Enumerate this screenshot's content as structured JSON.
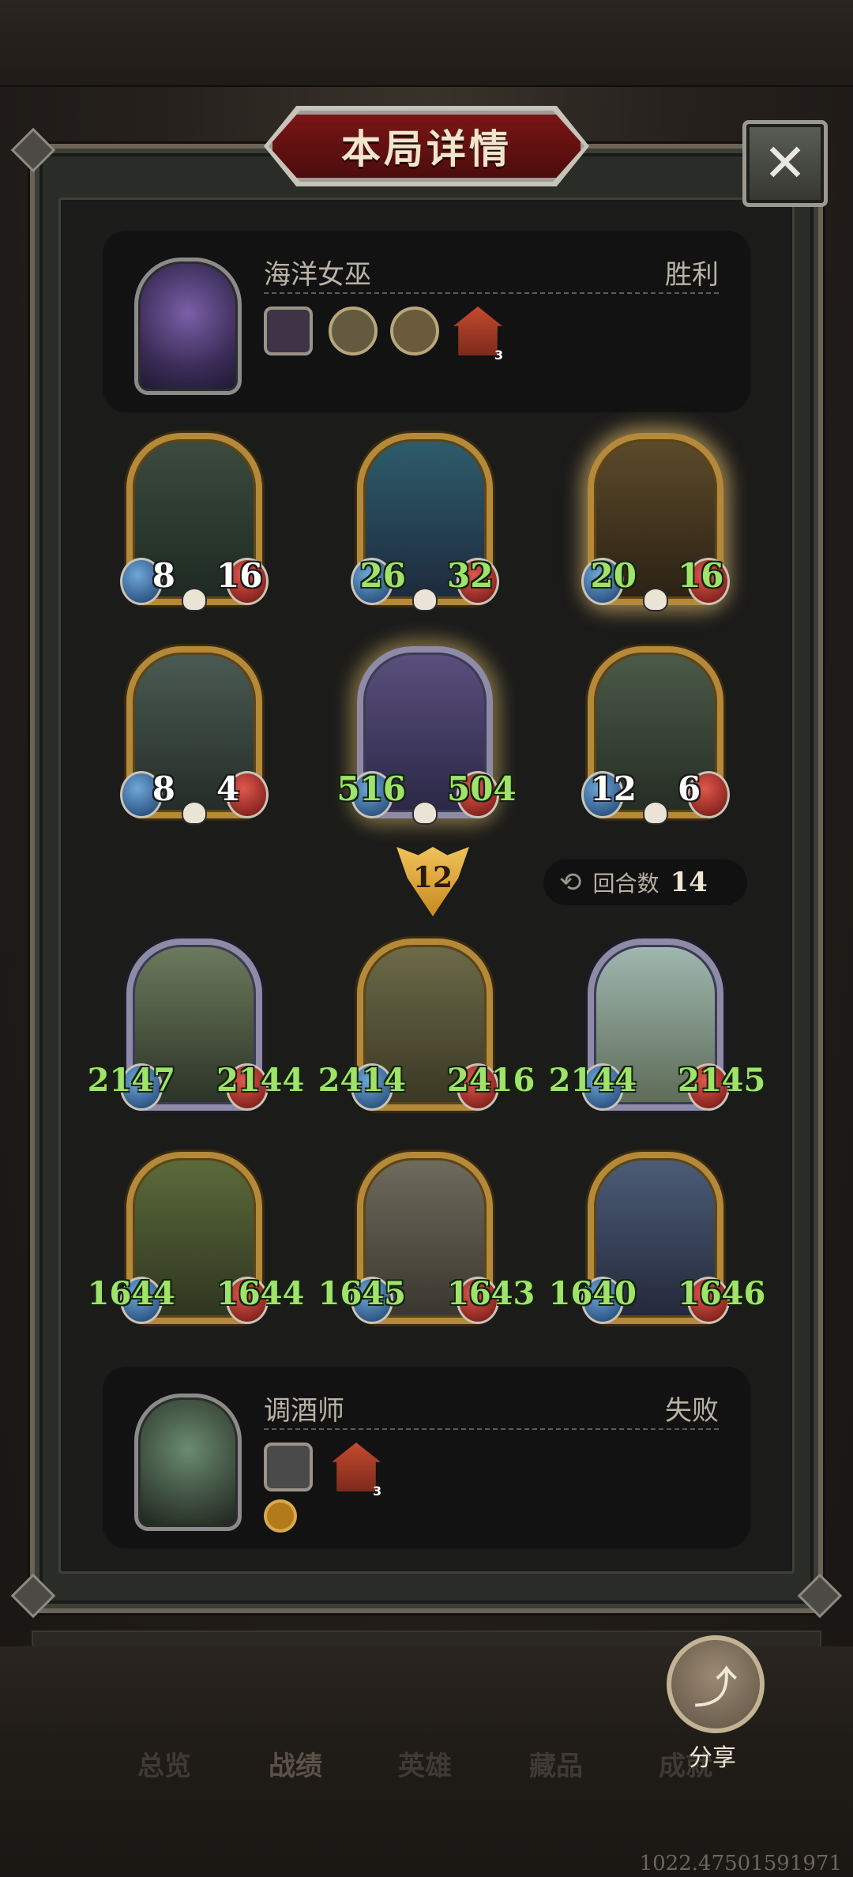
{
  "title": "本局详情",
  "close_icon": "close-icon",
  "top_player": {
    "name": "海洋女巫",
    "result": "胜利",
    "items": [
      "purple-creature-icon",
      "scroll-icon",
      "beast-icon",
      "house-icon"
    ],
    "house_count": "3"
  },
  "top_board": [
    {
      "atk": "8",
      "hp": "16",
      "num_style": "white",
      "frame": "gold",
      "glow": false
    },
    {
      "atk": "26",
      "hp": "32",
      "num_style": "green",
      "frame": "gold",
      "glow": false
    },
    {
      "atk": "20",
      "hp": "16",
      "num_style": "green",
      "frame": "gold",
      "glow": true
    },
    {
      "atk": "8",
      "hp": "4",
      "num_style": "white",
      "frame": "gold",
      "glow": false
    },
    {
      "atk": "516",
      "hp": "504",
      "num_style": "green",
      "frame": "silver",
      "glow": true
    },
    {
      "atk": "12",
      "hp": "6",
      "num_style": "white",
      "frame": "gold",
      "glow": false
    }
  ],
  "round_marker": "12",
  "rounds": {
    "label": "回合数",
    "value": "14"
  },
  "bottom_board": [
    {
      "atk": "2147",
      "hp": "2144",
      "num_style": "green",
      "frame": "silver"
    },
    {
      "atk": "2414",
      "hp": "2416",
      "num_style": "green",
      "frame": "gold"
    },
    {
      "atk": "2144",
      "hp": "2145",
      "num_style": "green",
      "frame": "silver"
    },
    {
      "atk": "1644",
      "hp": "1644",
      "num_style": "green",
      "frame": "gold"
    },
    {
      "atk": "1645",
      "hp": "1643",
      "num_style": "green",
      "frame": "gold"
    },
    {
      "atk": "1640",
      "hp": "1646",
      "num_style": "green",
      "frame": "gold"
    }
  ],
  "bottom_player": {
    "name": "调酒师",
    "result": "失败",
    "items": [
      "shaker-icon",
      "house-icon",
      "coin-icon"
    ],
    "house_count": "3"
  },
  "nav": [
    "总览",
    "战绩",
    "英雄",
    "藏品",
    "成就"
  ],
  "share_label": "分享",
  "version": "1022.47501591971"
}
